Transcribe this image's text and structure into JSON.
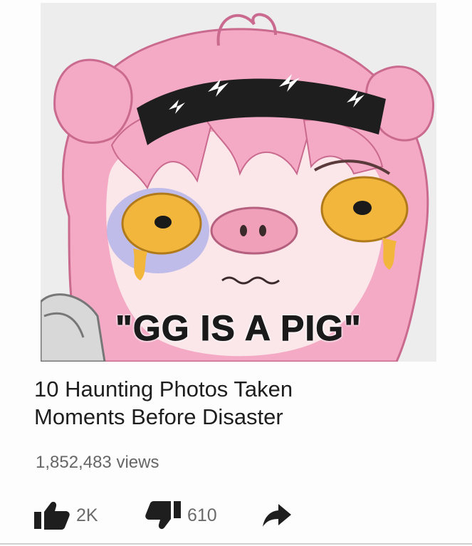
{
  "thumbnail": {
    "caption": "\"GG IS A PIG\""
  },
  "video": {
    "title_line1": "10 Haunting Photos Taken",
    "title_line2": "Moments Before Disaster",
    "views": "1,852,483 views"
  },
  "actions": {
    "like_icon": "thumbs-up-icon",
    "like_count": "2K",
    "dislike_icon": "thumbs-down-icon",
    "dislike_count": "610",
    "share_icon": "share-arrow-icon"
  },
  "colors": {
    "hair_pink": "#f4a9c4",
    "eye_yellow": "#f2b63c",
    "headband": "#1e1e1e",
    "text_dark": "#1e1e1e",
    "text_muted": "#666666"
  }
}
